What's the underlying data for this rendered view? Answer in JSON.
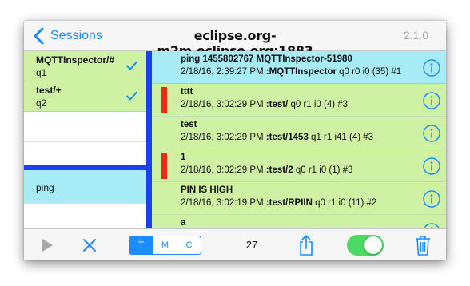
{
  "navbar": {
    "back_label": "Sessions",
    "title": "eclipse.org-m2m.eclipse.org:1883",
    "version": "2.1.0"
  },
  "subscriptions": [
    {
      "topic": "MQTTInspector/#",
      "qos": "q1",
      "checked": true
    },
    {
      "topic": "test/+",
      "qos": "q2",
      "checked": true
    }
  ],
  "publications": [
    {
      "topic": "ping"
    }
  ],
  "messages": [
    {
      "payload": "ping 1455802767 MQTTInspector-51980",
      "timestamp": "2/18/16, 2:39:27 PM",
      "topic": ":MQTTInspector",
      "meta": "q0 r0 i0 (35) #1",
      "color": "cyan",
      "flagged": false
    },
    {
      "payload": "tttt",
      "timestamp": "2/18/16, 3:02:29 PM",
      "topic": ":test/",
      "meta": "q0 r1 i0 (4) #3",
      "color": "green",
      "flagged": true
    },
    {
      "payload": "test",
      "timestamp": "2/18/16, 3:02:29 PM",
      "topic": ":test/1453",
      "meta": "q1 r1 i41 (4) #3",
      "color": "green",
      "flagged": false
    },
    {
      "payload": "1",
      "timestamp": "2/18/16, 3:02:29 PM",
      "topic": ":test/2",
      "meta": "q0 r1 i0 (1) #3",
      "color": "green",
      "flagged": true
    },
    {
      "payload": "PIN IS HIGH",
      "timestamp": "2/18/16, 3:02:19 PM",
      "topic": ":test/RPIIN",
      "meta": "q0 r1 i0 (11) #2",
      "color": "green",
      "flagged": false
    },
    {
      "payload": "a",
      "timestamp": "",
      "topic": "",
      "meta": "",
      "color": "green",
      "flagged": false
    }
  ],
  "toolbar": {
    "segments": [
      {
        "label": "T",
        "selected": true
      },
      {
        "label": "M",
        "selected": false
      },
      {
        "label": "C",
        "selected": false
      }
    ],
    "count": "27",
    "toggle_on": true
  },
  "colors": {
    "accent": "#1a8cff",
    "divider": "#1c3ef5",
    "sub_row": "#cff1a4",
    "pub_row": "#a8ecf7",
    "flag": "#ef2a0e",
    "toggle": "#4cd964"
  },
  "icons": [
    "chevron-left-icon",
    "checkmark-icon",
    "info-icon",
    "play-icon",
    "close-icon",
    "share-icon",
    "trash-icon"
  ]
}
